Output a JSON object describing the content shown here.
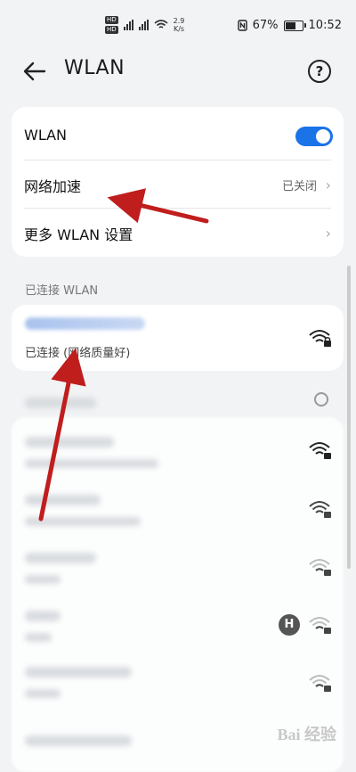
{
  "status_bar": {
    "hd1": "HD",
    "hd2": "HD",
    "net_speed": "2.9",
    "net_unit": "K/s",
    "battery": "67%",
    "battery_level": 0.67,
    "time": "10:52"
  },
  "header": {
    "title": "WLAN",
    "help": "?"
  },
  "settings": {
    "wlan_label": "WLAN",
    "wlan_enabled": true,
    "accel_label": "网络加速",
    "accel_value": "已关闭",
    "more_label": "更多 WLAN 设置"
  },
  "connected_section": {
    "title": "已连接 WLAN",
    "status": "已连接 (网络质量好)"
  },
  "watermark": "Bai 经验",
  "colors": {
    "accent": "#1b73e8",
    "arrow": "#c01d1d"
  }
}
